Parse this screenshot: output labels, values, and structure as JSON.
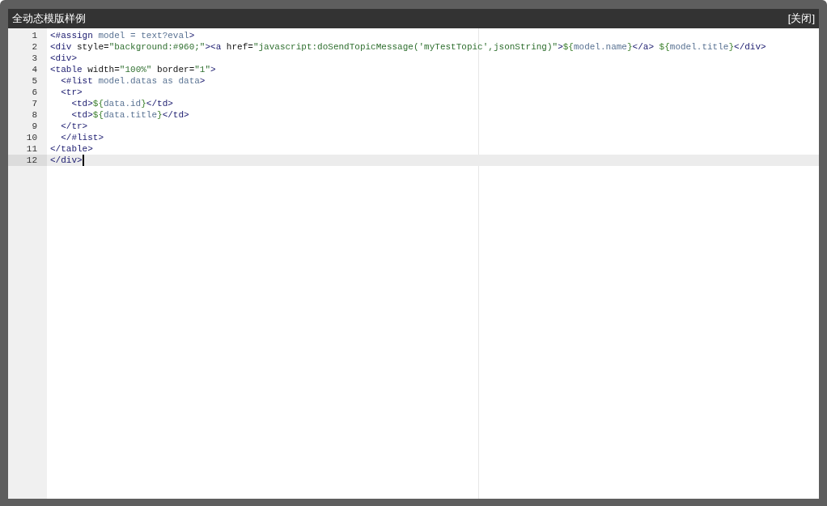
{
  "window": {
    "title": "全动态模版样例",
    "close_label": "[关闭]"
  },
  "editor": {
    "lines": [
      {
        "number": "1",
        "active": false,
        "tokens": [
          {
            "kind": "directive",
            "text": "<#assign"
          },
          {
            "kind": "ftl",
            "text": " model = text?eval"
          },
          {
            "kind": "directive",
            "text": ">"
          }
        ]
      },
      {
        "number": "2",
        "active": false,
        "tokens": [
          {
            "kind": "tag",
            "text": "<div"
          },
          {
            "kind": "attr",
            "text": " style="
          },
          {
            "kind": "string",
            "text": "\"background:#960;\""
          },
          {
            "kind": "tag",
            "text": "><a"
          },
          {
            "kind": "attr",
            "text": " href="
          },
          {
            "kind": "string",
            "text": "\"javascript:doSendTopicMessage('myTestTopic',jsonString)\""
          },
          {
            "kind": "tag",
            "text": ">"
          },
          {
            "kind": "delim",
            "text": "${"
          },
          {
            "kind": "ftl",
            "text": "model.name"
          },
          {
            "kind": "delim",
            "text": "}"
          },
          {
            "kind": "tag",
            "text": "</a>"
          },
          {
            "kind": "delim",
            "text": " ${"
          },
          {
            "kind": "ftl",
            "text": "model.title"
          },
          {
            "kind": "delim",
            "text": "}"
          },
          {
            "kind": "tag",
            "text": "</div>"
          }
        ]
      },
      {
        "number": "3",
        "active": false,
        "tokens": [
          {
            "kind": "tag",
            "text": "<div>"
          }
        ]
      },
      {
        "number": "4",
        "active": false,
        "tokens": [
          {
            "kind": "tag",
            "text": "<table"
          },
          {
            "kind": "attr",
            "text": " width="
          },
          {
            "kind": "string",
            "text": "\"100%\""
          },
          {
            "kind": "attr",
            "text": " border="
          },
          {
            "kind": "string",
            "text": "\"1\""
          },
          {
            "kind": "tag",
            "text": ">"
          }
        ]
      },
      {
        "number": "5",
        "active": false,
        "tokens": [
          {
            "kind": "directive",
            "text": "  <#list"
          },
          {
            "kind": "ftl",
            "text": " model.datas as data"
          },
          {
            "kind": "directive",
            "text": ">"
          }
        ]
      },
      {
        "number": "6",
        "active": false,
        "tokens": [
          {
            "kind": "tag",
            "text": "  <tr>"
          }
        ]
      },
      {
        "number": "7",
        "active": false,
        "tokens": [
          {
            "kind": "tag",
            "text": "    <td>"
          },
          {
            "kind": "delim",
            "text": "${"
          },
          {
            "kind": "ftl",
            "text": "data.id"
          },
          {
            "kind": "delim",
            "text": "}"
          },
          {
            "kind": "tag",
            "text": "</td>"
          }
        ]
      },
      {
        "number": "8",
        "active": false,
        "tokens": [
          {
            "kind": "tag",
            "text": "    <td>"
          },
          {
            "kind": "delim",
            "text": "${"
          },
          {
            "kind": "ftl",
            "text": "data.title"
          },
          {
            "kind": "delim",
            "text": "}"
          },
          {
            "kind": "tag",
            "text": "</td>"
          }
        ]
      },
      {
        "number": "9",
        "active": false,
        "tokens": [
          {
            "kind": "tag",
            "text": "  </tr>"
          }
        ]
      },
      {
        "number": "10",
        "active": false,
        "tokens": [
          {
            "kind": "directive",
            "text": "  </#list>"
          }
        ]
      },
      {
        "number": "11",
        "active": false,
        "tokens": [
          {
            "kind": "tag",
            "text": "</table>"
          }
        ]
      },
      {
        "number": "12",
        "active": true,
        "tokens": [
          {
            "kind": "tag",
            "text": "</div>"
          }
        ]
      }
    ]
  }
}
